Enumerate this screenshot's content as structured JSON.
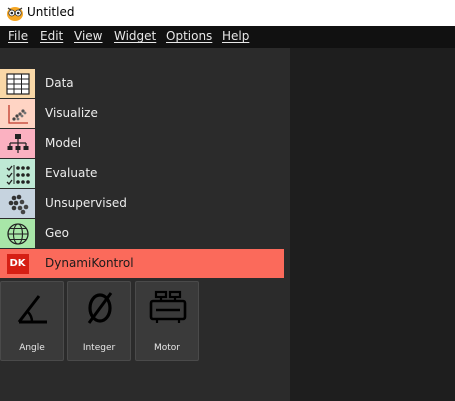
{
  "window": {
    "title": "Untitled",
    "icon": "orange-owl-app-icon"
  },
  "menubar": {
    "items": [
      "File",
      "Edit",
      "View",
      "Widget",
      "Options",
      "Help"
    ]
  },
  "categories": [
    {
      "label": "Data",
      "icon": "data-table-icon",
      "color": "#f9d8a7"
    },
    {
      "label": "Visualize",
      "icon": "scatter-plot-icon",
      "color": "#ffd4c4"
    },
    {
      "label": "Model",
      "icon": "tree-model-icon",
      "color": "#fbb1c1"
    },
    {
      "label": "Evaluate",
      "icon": "checklist-evaluate-icon",
      "color": "#bfe9d5"
    },
    {
      "label": "Unsupervised",
      "icon": "clusters-icon",
      "color": "#c6d3df"
    },
    {
      "label": "Geo",
      "icon": "globe-icon",
      "color": "#a8e6a8"
    },
    {
      "label": "DynamiKontrol",
      "icon": "dk-logo-icon",
      "color": "#fb6a5b",
      "badge": "DK",
      "badge_color": "#d61f14"
    }
  ],
  "widgets": [
    {
      "label": "Angle",
      "icon": "angle-icon"
    },
    {
      "label": "Integer",
      "icon": "empty-set-icon"
    },
    {
      "label": "Motor",
      "icon": "motor-icon"
    }
  ],
  "colors": {
    "panel_bg": "#2b2b2b",
    "canvas_bg": "#1e1e1e",
    "menubar_bg": "#111111",
    "active_category": "#fb6a5b"
  }
}
